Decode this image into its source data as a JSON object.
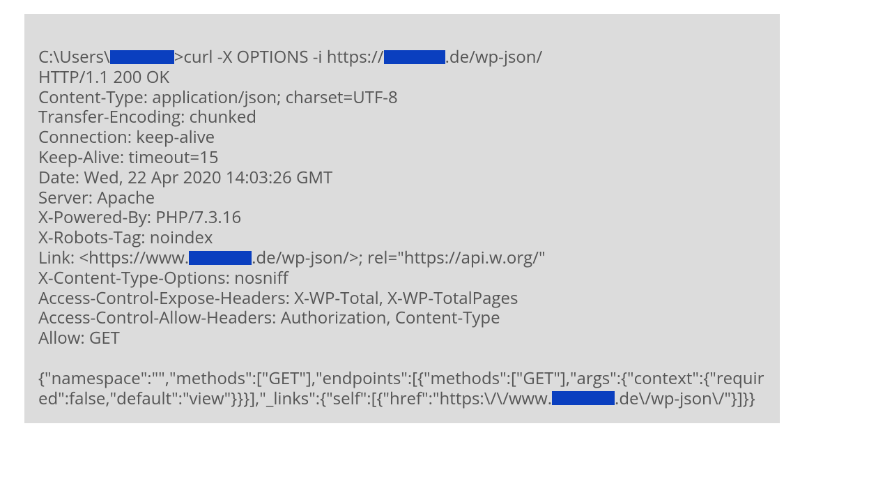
{
  "cmd": {
    "prefix": "C:\\Users\\",
    "mid": ">curl  -X OPTIONS -i https://",
    "suffix": ".de/wp-json/"
  },
  "headers": {
    "status": "HTTP/1.1 200 OK",
    "contentType": "Content-Type: application/json; charset=UTF-8",
    "transferEncoding": "Transfer-Encoding: chunked",
    "connection": "Connection: keep-alive",
    "keepAlive": "Keep-Alive: timeout=15",
    "date": "Date: Wed, 22 Apr 2020 14:03:26 GMT",
    "server": "Server: Apache",
    "poweredBy": "X-Powered-By: PHP/7.3.16",
    "robots": "X-Robots-Tag: noindex",
    "linkPrefix": "Link: <https://www.",
    "linkSuffix": ".de/wp-json/>; rel=\"https://api.w.org/\"",
    "xcto": "X-Content-Type-Options: nosniff",
    "aceh": "Access-Control-Expose-Headers:  X-WP-Total, X-WP-TotalPages",
    "acah": "Access-Control-Allow-Headers:  Authorization, Content-Type",
    "allow": "Allow: GET"
  },
  "body": {
    "part1": "{\"namespace\":\"\",\"methods\":[\"GET\"],\"endpoints\":[{\"methods\":[\"GET\"],\"args\":{\"context\":{\"required\":false,\"default\":\"view\"}}}],\"_links\":{\"self\":[{\"href\":\"https:\\/\\/www.",
    "part2": ".de\\/wp-json\\/\"}]}}"
  }
}
